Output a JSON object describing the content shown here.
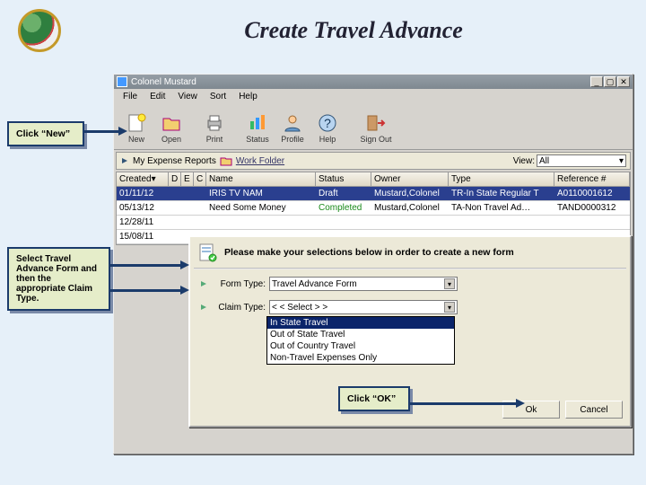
{
  "page_title": "Create Travel Advance",
  "window": {
    "title": "Colonel Mustard",
    "menu": [
      "File",
      "Edit",
      "View",
      "Sort",
      "Help"
    ],
    "toolbar": [
      {
        "label": "New",
        "icon": "new-icon"
      },
      {
        "label": "Open",
        "icon": "open-icon"
      },
      {
        "label": "Print",
        "icon": "print-icon"
      },
      {
        "label": "Status",
        "icon": "status-icon"
      },
      {
        "label": "Profile",
        "icon": "profile-icon"
      },
      {
        "label": "Help",
        "icon": "help-icon"
      },
      {
        "label": "Sign Out",
        "icon": "signout-icon"
      }
    ],
    "pane": {
      "title": "My Expense Reports",
      "subfolder": "Work Folder",
      "view_label": "View:",
      "view_value": "All"
    },
    "grid": {
      "columns": [
        "Created▾",
        "D",
        "E",
        "C",
        "Name",
        "Status",
        "Owner",
        "Type",
        "Reference #"
      ],
      "rows": [
        {
          "created": "01/11/12",
          "name": "IRIS TV NAM",
          "status": "Draft",
          "owner": "Mustard,Colonel",
          "type": "TR-In State Regular T",
          "ref": "A0110001612"
        },
        {
          "created": "05/13/12",
          "name": "Need Some Money",
          "status": "Completed",
          "owner": "Mustard,Colonel",
          "type": "TA-Non Travel Ad…",
          "ref": "TAND0000312"
        },
        {
          "created": "12/28/11",
          "name": "",
          "status": "",
          "owner": "",
          "type": "",
          "ref": ""
        },
        {
          "created": "15/08/11",
          "name": "",
          "status": "",
          "owner": "",
          "type": "",
          "ref": ""
        }
      ]
    }
  },
  "dialog": {
    "header": "Please make your selections below in order to create a new form",
    "form_type_label": "Form Type:",
    "form_type_value": "Travel Advance Form",
    "claim_type_label": "Claim Type:",
    "claim_type_value": "< < Select > >",
    "claim_options": [
      "In State Travel",
      "Out of State Travel",
      "Out of Country Travel",
      "Non-Travel Expenses Only"
    ],
    "ok_label": "Ok",
    "cancel_label": "Cancel"
  },
  "callouts": {
    "new": "Click “New”",
    "select": "Select Travel Advance Form and then the appropriate Claim Type.",
    "ok": "Click “OK”"
  }
}
